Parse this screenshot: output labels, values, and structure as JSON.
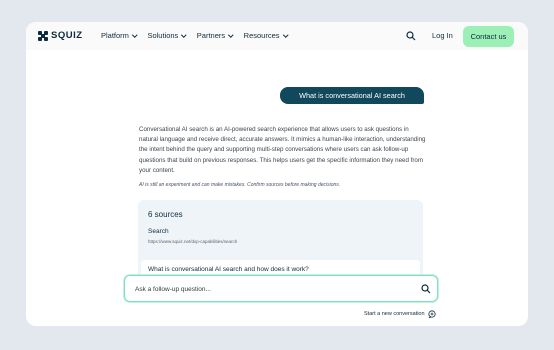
{
  "brand": {
    "name": "SQUIZ"
  },
  "nav": {
    "items": [
      {
        "label": "Platform"
      },
      {
        "label": "Solutions"
      },
      {
        "label": "Partners"
      },
      {
        "label": "Resources"
      }
    ],
    "login_label": "Log In",
    "contact_label": "Contact us"
  },
  "chat": {
    "question": "What is conversational AI search",
    "answer": "Conversational AI search is an AI-powered search experience that allows users to ask questions in natural language and receive direct, accurate answers. It mimics a human-like interaction, understanding the intent behind the query and supporting multi-step conversations where users can ask follow-up questions that build on previous responses. This helps users get the specific information they need from your content.",
    "disclaimer": "AI is still an experiment and can make mistakes. Confirm sources before making decisions."
  },
  "sources": {
    "title": "6 sources",
    "items": [
      {
        "title": "Search",
        "url": "https://www.squiz.net/dxp-capabilities/search"
      },
      {
        "title": "What is conversational AI search and how does it work?"
      }
    ]
  },
  "followup": {
    "placeholder": "Ask a follow-up question..."
  },
  "new_conversation_label": "Start a new conversation",
  "colors": {
    "brand_dark": "#0d2b3e",
    "accent_green": "#9cf0b6",
    "pill_bg": "#12485c"
  }
}
